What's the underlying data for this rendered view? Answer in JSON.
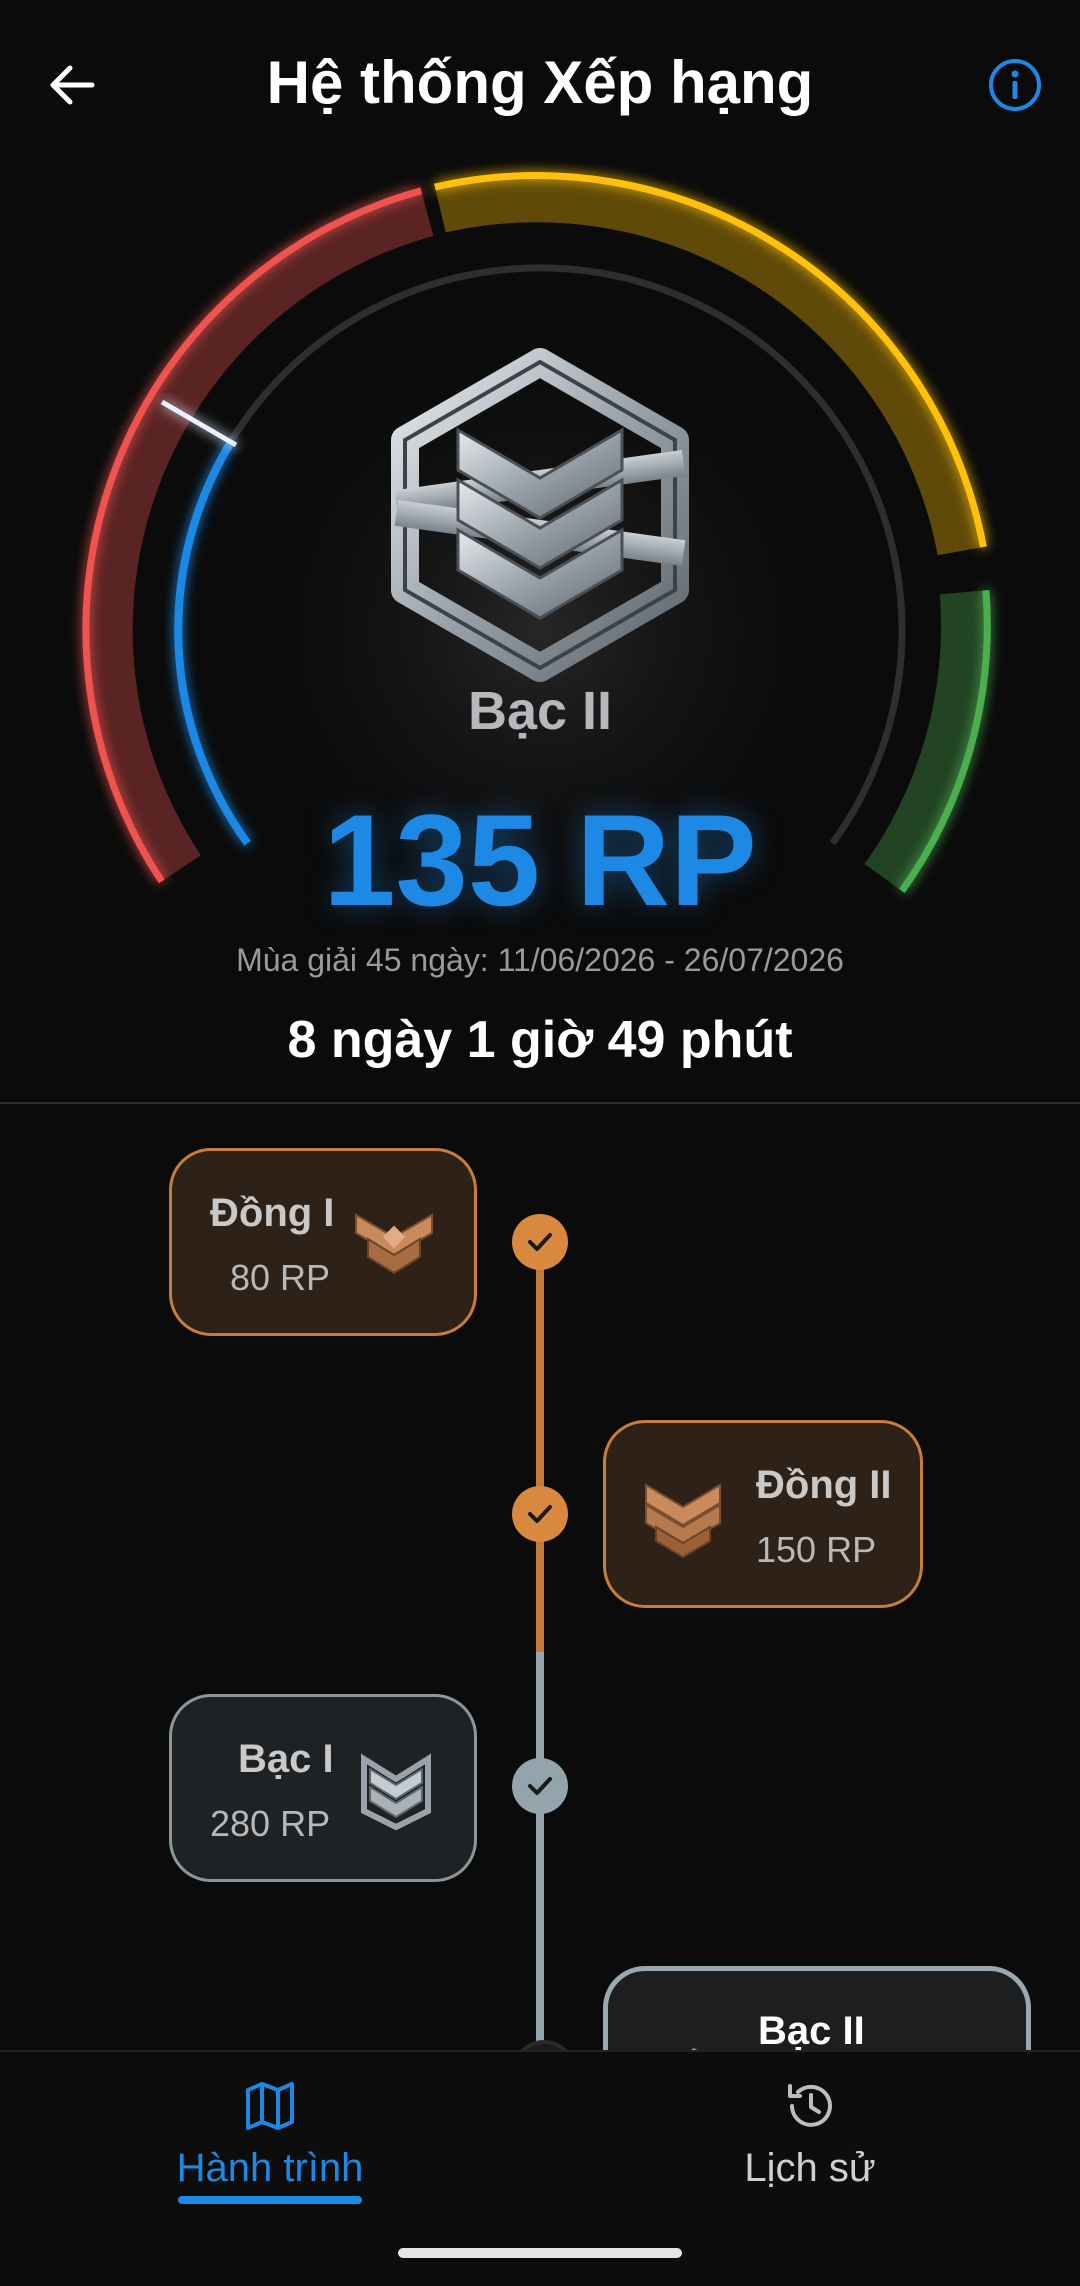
{
  "header": {
    "title": "Hệ thống Xếp hạng",
    "back_icon": "arrow-left-icon",
    "info_icon": "info-circle-icon"
  },
  "current_rank": {
    "name": "Bạc II",
    "points": "135 RP",
    "progress_fraction": 0.35
  },
  "season": {
    "label": "Mùa giải 45 ngày: 11/06/2026 - 26/07/2026",
    "countdown": "8 ngày 1 giờ 49 phút"
  },
  "colors": {
    "accent": "#1e88e5",
    "red_zone": "#ef5350",
    "yellow_zone": "#ffc107",
    "green_zone": "#4caf50",
    "bronze": "#d9893d",
    "silver": "#93a4ad"
  },
  "tiers": [
    {
      "name": "Đồng I",
      "points": "80 RP",
      "status": "completed",
      "tier": "bronze"
    },
    {
      "name": "Đồng II",
      "points": "150 RP",
      "status": "completed",
      "tier": "bronze"
    },
    {
      "name": "Bạc I",
      "points": "280 RP",
      "status": "completed",
      "tier": "silver"
    },
    {
      "name": "Bạc II",
      "status": "current",
      "tier": "silver"
    }
  ],
  "bottom_nav": {
    "tabs": [
      {
        "label": "Hành trình",
        "icon": "map-icon",
        "active": true
      },
      {
        "label": "Lịch sử",
        "icon": "history-icon",
        "active": false
      }
    ]
  }
}
